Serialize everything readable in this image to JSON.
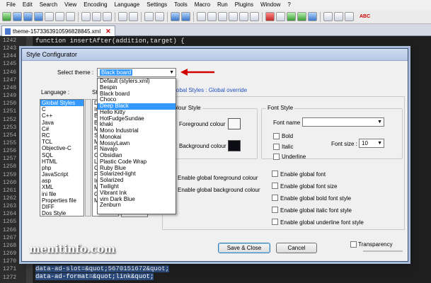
{
  "menubar": [
    "File",
    "Edit",
    "Search",
    "View",
    "Encoding",
    "Language",
    "Settings",
    "Tools",
    "Macro",
    "Run",
    "Plugins",
    "Window",
    "?"
  ],
  "toolbar": {
    "spellcheck_label": "ABC"
  },
  "tab": {
    "filename": "theme-1573363910596828845.xml"
  },
  "editor": {
    "line_numbers": [
      "1242",
      "1243",
      "1244",
      "1245",
      "1246",
      "1247",
      "1248",
      "1249",
      "1250",
      "1251",
      "1252",
      "1253",
      "1254",
      "1255",
      "1256",
      "1257",
      "1258",
      "1259",
      "1260",
      "1261",
      "1262",
      "1263",
      "1264",
      "1265",
      "1266",
      "1267",
      "1268",
      "1269",
      "1270",
      "1271",
      "1272"
    ],
    "top_code": "function insertAfter(addition,target) {",
    "bottom_code": [
      "data-ad-slot=&quot;5670151672&quot;",
      "data-ad-format=&quot;link&quot;"
    ]
  },
  "dialog": {
    "title": "Style Configurator",
    "theme_label": "Select theme :",
    "theme_selected": "Black board",
    "language_label": "Language :",
    "style_label": "St",
    "global_title": "Global Styles : Global override",
    "languages": [
      "Global Styles",
      "C",
      "C++",
      "Java",
      "C#",
      "RC",
      "TCL",
      "Objective-C",
      "SQL",
      "HTML",
      "php",
      "JavaScript",
      "asp",
      "XML",
      "ini file",
      "Properties file",
      "DIFF",
      "Dos Style"
    ],
    "style_partial": [
      "De",
      "In",
      "Br",
      "Bi",
      "Mi",
      "Sm",
      "M",
      "Fo",
      "Ca",
      "Li",
      "Cu",
      "Fo",
      "In",
      "M",
      "Gl",
      "M"
    ],
    "theme_options": [
      "Default (stylers.xml)",
      "Bespin",
      "Black board",
      "Choco",
      "Deep Black",
      "Hello Kitty",
      "HotFudgeSundae",
      "khaki",
      "Mono Industrial",
      "Monokai",
      "MossyLawn",
      "Navajo",
      "Obsidian",
      "Plastic Code Wrap",
      "Ruby Blue",
      "Solarized-light",
      "Solarized",
      "Twilight",
      "Vibrant Ink",
      "vim Dark Blue",
      "Zenburn"
    ],
    "theme_highlighted_index": 4,
    "colour_style": {
      "legend": "Colour Style",
      "foreground_label": "Foreground colour",
      "background_label": "Background colour",
      "foreground_color": "#f8f8f8",
      "background_color": "#0c0c14"
    },
    "font_style": {
      "legend": "Font Style",
      "font_name_label": "Font name :",
      "bold_label": "Bold",
      "italic_label": "Italic",
      "underline_label": "Underline",
      "font_size_label": "Font size :",
      "font_size_value": "10"
    },
    "enable_global": [
      "Enable global foreground colour",
      "Enable global background colour"
    ],
    "enable_font": [
      "Enable global font",
      "Enable global font size",
      "Enable global bold font style",
      "Enable global italic font style",
      "Enable global underline font style"
    ],
    "save_label": "Save & Close",
    "cancel_label": "Cancel",
    "transparency_label": "Transparency"
  },
  "watermark": "menitinfo.com",
  "colors": {
    "accent_select": "#3399ff",
    "annotation_arrow": "#d40000"
  }
}
